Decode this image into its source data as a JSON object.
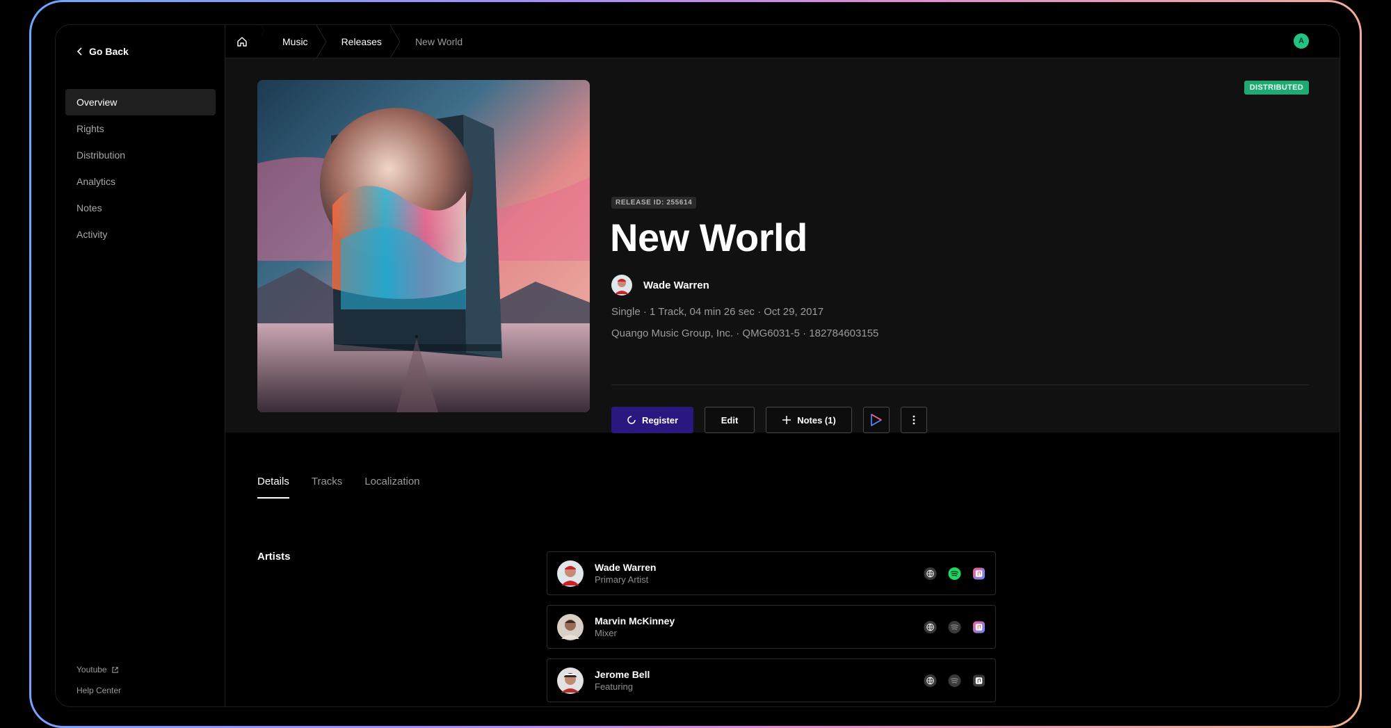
{
  "sidebar": {
    "go_back": "Go Back",
    "items": [
      {
        "label": "Overview",
        "active": true
      },
      {
        "label": "Rights"
      },
      {
        "label": "Distribution"
      },
      {
        "label": "Analytics"
      },
      {
        "label": "Notes"
      },
      {
        "label": "Activity"
      }
    ],
    "footer": {
      "youtube": "Youtube",
      "help": "Help Center"
    }
  },
  "breadcrumb": {
    "music": "Music",
    "releases": "Releases",
    "current": "New World"
  },
  "user": {
    "initial": "A"
  },
  "release": {
    "status": "DISTRIBUTED",
    "release_id_label": "RELEASE ID: 255614",
    "title": "New World",
    "artist": "Wade Warren",
    "meta_line_1": "Single · 1 Track, 04 min 26 sec · Oct 29, 2017",
    "meta_line_2": "Quango Music Group, Inc. · QMG6031-5 · 182784603155"
  },
  "actions": {
    "register": "Register",
    "edit": "Edit",
    "notes": "Notes (1)"
  },
  "tabs": [
    "Details",
    "Tracks",
    "Localization"
  ],
  "details": {
    "artists_label": "Artists",
    "artists": [
      {
        "name": "Wade Warren",
        "role": "Primary Artist",
        "spotify_active": true,
        "apple_active": true
      },
      {
        "name": "Marvin McKinney",
        "role": "Mixer",
        "spotify_active": false,
        "apple_active": true
      },
      {
        "name": "Jerome Bell",
        "role": "Featuring",
        "spotify_active": false,
        "apple_active": false
      }
    ]
  },
  "colors": {
    "accent": "#2a1780",
    "status": "#1faa72",
    "spotify": "#1ed760",
    "background": "#111111"
  }
}
